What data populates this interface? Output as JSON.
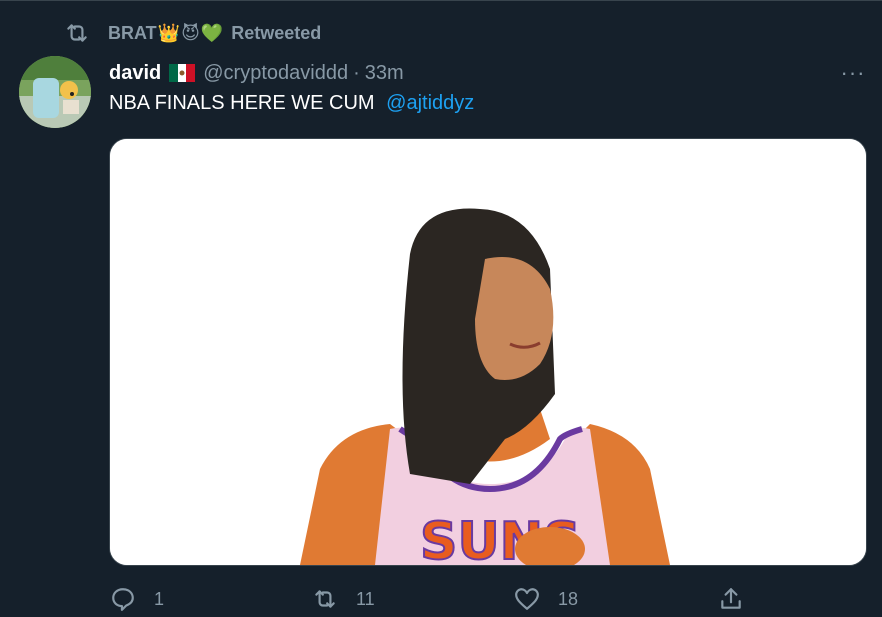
{
  "retweet": {
    "label": "BRAT",
    "emoji1": "👑",
    "emoji2": "😈",
    "emoji3": "💚",
    "status": "Retweeted"
  },
  "tweet": {
    "author_name": "david",
    "flag": "🇲🇽",
    "handle": "@cryptodaviddd",
    "separator": "·",
    "time": "33m",
    "more": "···",
    "text": "NBA FINALS HERE WE CUM",
    "mention": "@ajtiddyz",
    "media_jersey_text": "SUNS"
  },
  "actions": {
    "reply_count": "1",
    "retweet_count": "11",
    "like_count": "18"
  },
  "colors": {
    "background": "#15202b",
    "muted": "#8899a6",
    "link": "#1da1f2",
    "border": "#38444d"
  }
}
